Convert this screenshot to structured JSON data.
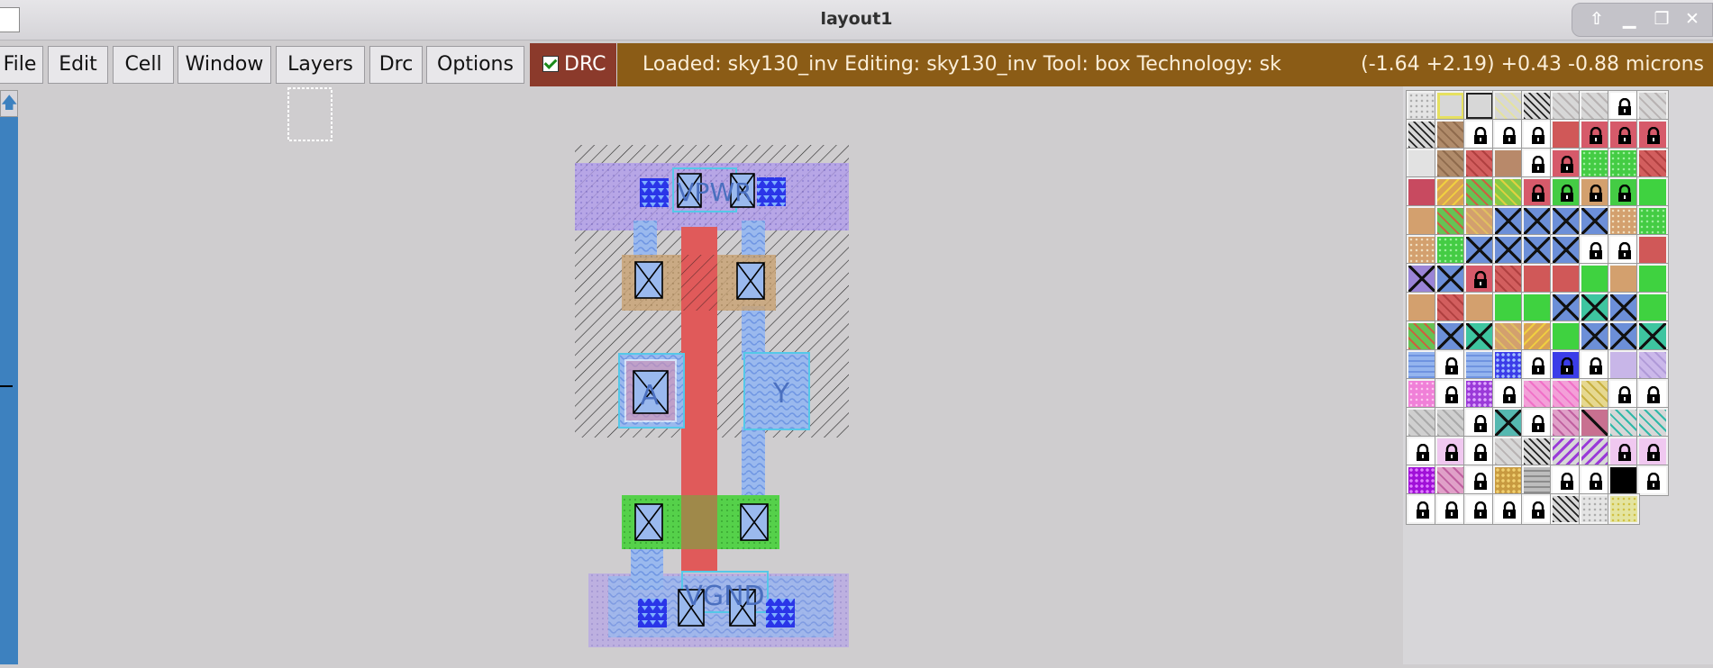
{
  "window": {
    "title": "layout1"
  },
  "menus": [
    "File",
    "Edit",
    "Cell",
    "Window",
    "Layers",
    "Drc",
    "Options"
  ],
  "drc": {
    "label": "DRC",
    "checked": true
  },
  "status": {
    "message": "Loaded: sky130_inv Editing: sky130_inv Tool: box  Technology: sk",
    "coords": "(-1.64 +2.19) +0.43 -0.88 microns"
  },
  "layout": {
    "labels": {
      "vpwr": "VPWR",
      "a": "A",
      "y": "Y",
      "vgnd": "VGND"
    }
  },
  "colors": {
    "status_bg": "#8b5c16",
    "drc_bg": "#8b3a2b",
    "poly": "#e05a5a",
    "metal1": "#8ab4ee",
    "nwell": "#a89ce8",
    "diff": "#56d24a"
  },
  "palette": [
    [
      "dots",
      "yellow-outline",
      "black-outline",
      "yellow-hatch",
      "black-hatch",
      "gray-hatch",
      "gray-hatch",
      "lock-white",
      "gray-hatch"
    ],
    [
      "black-hatch",
      "brown-cross",
      "lock-white",
      "lock-white",
      "lock-white",
      "red-solid",
      "lock-red",
      "lock-red",
      "lock-red"
    ],
    [
      "lightgray",
      "brown-cross",
      "red-hatch",
      "brown-solid",
      "lock-white",
      "lock-red",
      "green-dots",
      "green-dots",
      "red-hatch"
    ],
    [
      "crimson",
      "orange-hatch",
      "green-hatch",
      "yellowgreen-hatch",
      "lock-red",
      "lock-green",
      "lock-tan",
      "lock-green",
      "green-solid"
    ],
    [
      "tan",
      "green-hatch",
      "tan-hatch",
      "x-blue",
      "x-blue",
      "x-blue",
      "x-blue",
      "tan-dots",
      "green-dots"
    ],
    [
      "tan-dots",
      "green-dots",
      "x-blue",
      "x-blue",
      "x-blue",
      "x-blue",
      "lock-white",
      "lock-white",
      "red-solid"
    ],
    [
      "x-purple",
      "x-blue",
      "lock-red",
      "red-hatch",
      "red-solid",
      "red-solid",
      "green-solid",
      "tan",
      "green-solid"
    ],
    [
      "tan",
      "red-hatch",
      "tan",
      "green-solid",
      "green-solid",
      "x-blue",
      "x-green",
      "x-blue",
      "green-solid"
    ],
    [
      "green-hatch",
      "x-blue",
      "x-green",
      "tan-hatch",
      "orange-hatch",
      "green-solid",
      "x-blue",
      "x-blue",
      "x-green"
    ],
    [
      "blue-wave",
      "lock-white",
      "blue-wave",
      "blue-pattern",
      "lock-white",
      "lock-blue",
      "lock-white",
      "lavender",
      "lavender-hatch"
    ],
    [
      "pink-dots",
      "lock-white",
      "purple-pattern",
      "lock-white",
      "pink-cross",
      "pink-cross",
      "yellow-cross",
      "lock-white",
      "lock-white"
    ],
    [
      "gray-cross",
      "gray-cross",
      "lock-white",
      "x-teal",
      "lock-white",
      "pink-hatch",
      "x-maroon",
      "teal-hatch",
      "teal-hatch"
    ],
    [
      "lock-white",
      "lock-purple",
      "lock-white",
      "gray-hatch",
      "black-hatch",
      "purple-hatch",
      "purple-hatch",
      "lock-purple",
      "lock-purple"
    ],
    [
      "purple-dots",
      "pink-hatch",
      "lock-white",
      "gold-dots",
      "gray-wave",
      "lock-white",
      "lock-white",
      "black",
      "lock-white"
    ],
    [
      "lock-white",
      "lock-white",
      "lock-white",
      "lock-white",
      "lock-white",
      "black-hatch",
      "dots",
      "yellow-dots"
    ]
  ]
}
